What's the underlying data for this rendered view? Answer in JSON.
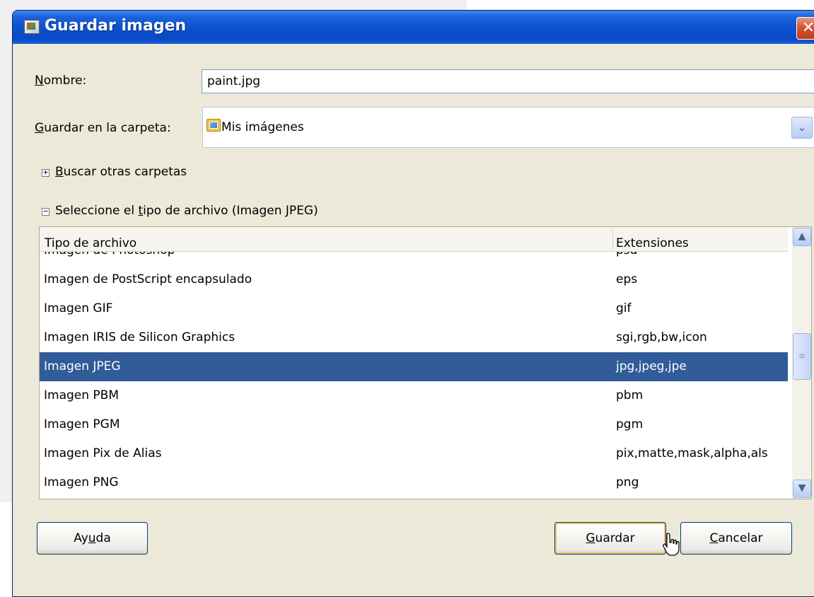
{
  "window": {
    "title": "Guardar imagen",
    "close_symbol": "✕"
  },
  "form": {
    "name_label_prefix": "N",
    "name_label_rest": "ombre:",
    "name_value": "paint.jpg",
    "folder_label_prefix": "G",
    "folder_label_rest": "uardar en la carpeta:",
    "folder_value": "Mis imágenes",
    "folder_icon": "pictures-folder-icon"
  },
  "expanders": {
    "browse": {
      "symbol": "+",
      "label_prefix": "B",
      "label_rest": "uscar otras carpetas"
    },
    "filetype": {
      "symbol": "−",
      "label_before": "Seleccione el ",
      "label_underlined": "t",
      "label_after": "ipo de archivo (Imagen JPEG)"
    }
  },
  "filetypes": {
    "columns": {
      "type": "Tipo de archivo",
      "ext": "Extensiones"
    },
    "rows": [
      {
        "type": "Imagen de Photoshop",
        "ext": "psd"
      },
      {
        "type": "Imagen de PostScript encapsulado",
        "ext": "eps"
      },
      {
        "type": "Imagen GIF",
        "ext": "gif"
      },
      {
        "type": "Imagen IRIS de Silicon Graphics",
        "ext": "sgi,rgb,bw,icon"
      },
      {
        "type": "Imagen JPEG",
        "ext": "jpg,jpeg,jpe",
        "selected": true
      },
      {
        "type": "Imagen PBM",
        "ext": "pbm"
      },
      {
        "type": "Imagen PGM",
        "ext": "pgm"
      },
      {
        "type": "Imagen Pix de Alias",
        "ext": "pix,matte,mask,alpha,als"
      },
      {
        "type": "Imagen PNG",
        "ext": "png"
      }
    ],
    "scroll_up": "▲",
    "scroll_down": "▼",
    "thumb_grip": "≡"
  },
  "buttons": {
    "help_before": "Ay",
    "help_underlined": "u",
    "help_after": "da",
    "save_underlined": "G",
    "save_after": "uardar",
    "cancel_underlined": "C",
    "cancel_after": "ancelar"
  },
  "colors": {
    "selection": "#315b99",
    "titlebar": "#0c52d0",
    "dialog_bg": "#ece9d8"
  }
}
